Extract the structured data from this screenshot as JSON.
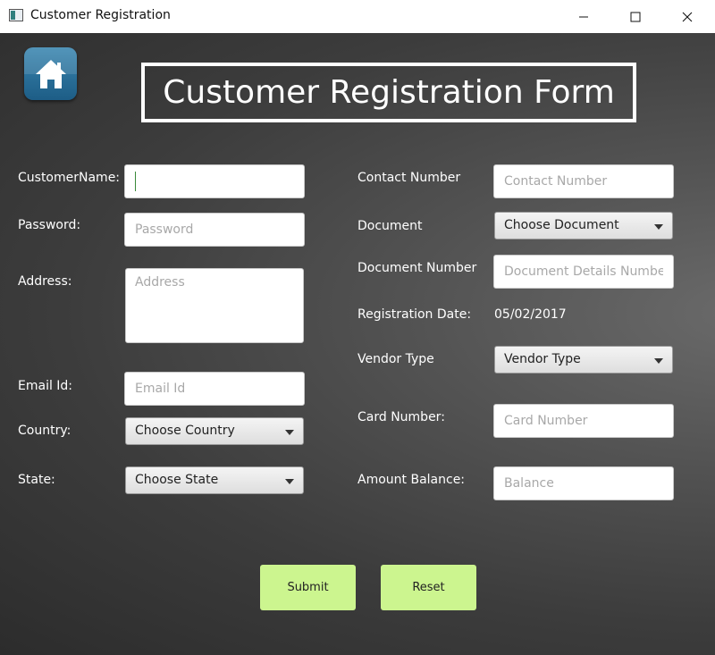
{
  "window": {
    "title": "Customer Registration"
  },
  "form": {
    "title": "Customer Registration Form",
    "left": {
      "customer_name_label": "CustomerName:",
      "customer_name_value": "",
      "password_label": "Password:",
      "password_placeholder": "Password",
      "address_label": "Address:",
      "address_placeholder": "Address",
      "email_label": "Email Id:",
      "email_placeholder": "Email Id",
      "country_label": "Country:",
      "country_value": "Choose Country",
      "state_label": "State:",
      "state_value": "Choose State"
    },
    "right": {
      "contact_label": "Contact Number",
      "contact_placeholder": "Contact Number",
      "document_label": "Document",
      "document_value": "Choose Document",
      "document_number_label": "Document Number",
      "document_number_placeholder": "Document Details Number",
      "registration_date_label": "Registration Date:",
      "registration_date_value": "05/02/2017",
      "vendor_type_label": "Vendor Type",
      "vendor_type_value": "Vendor Type",
      "card_number_label": "Card Number:",
      "card_number_placeholder": "Card Number",
      "amount_balance_label": "Amount Balance:",
      "amount_balance_placeholder": "Balance"
    },
    "buttons": {
      "submit": "Submit",
      "reset": "Reset"
    }
  },
  "colors": {
    "button_accent": "#ccf58f",
    "home_button": "#2a73a0"
  },
  "icons": {
    "home": "home-icon",
    "minimize": "minimize-icon",
    "maximize": "maximize-icon",
    "close": "close-icon",
    "dropdown": "chevron-down-icon"
  }
}
